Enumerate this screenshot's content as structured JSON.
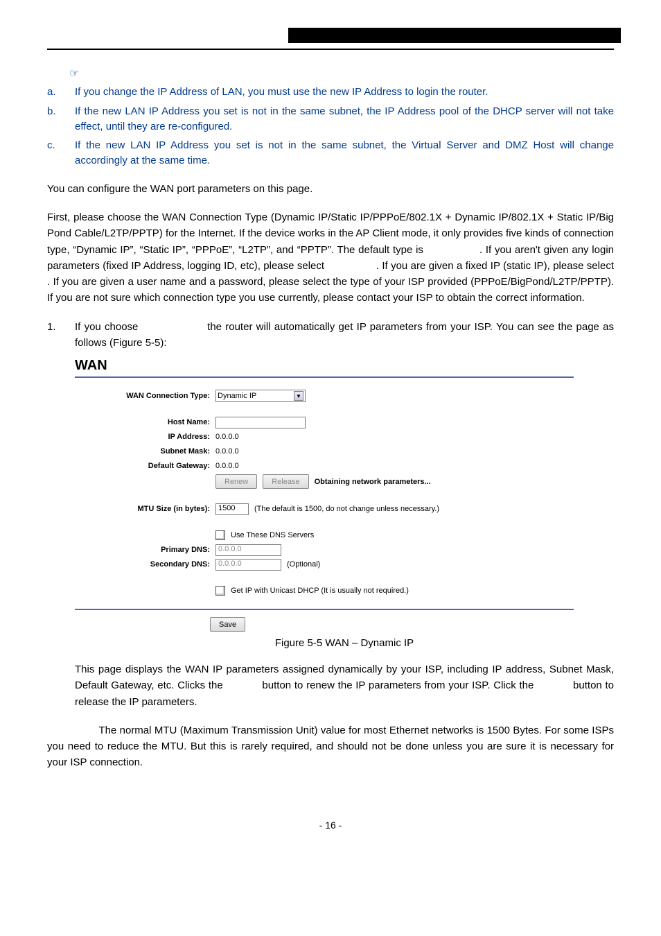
{
  "notes": {
    "hand": "☞",
    "items": [
      {
        "letter": "a.",
        "text": "If you change the IP Address of LAN, you must use the new IP Address to login the router."
      },
      {
        "letter": "b.",
        "text": "If the new LAN IP Address you set is not in the same subnet, the IP Address pool of the DHCP server will not take effect, until they are re-configured."
      },
      {
        "letter": "c.",
        "text": "If the new LAN IP Address you set is not in the same subnet, the Virtual Server and DMZ Host will change accordingly at the same time."
      }
    ]
  },
  "para1": "You can configure the WAN port parameters on this page.",
  "para2": "First, please choose the WAN Connection Type (Dynamic IP/Static IP/PPPoE/802.1X + Dynamic IP/802.1X + Static IP/Big Pond Cable/L2TP/PPTP) for the Internet. If the device works in the AP Client mode, it only provides five kinds of connection type, “Dynamic IP”, “Static IP”, “PPPoE”, “L2TP”, and “PPTP”. The default type is                 . If you aren't given any login parameters (fixed IP Address, logging ID, etc), please select                 . If you are given a fixed IP (static IP), please select             . If you are given a user name and a password, please select the type of your ISP provided (PPPoE/BigPond/L2TP/PPTP). If you are not sure which connection type you use currently, please contact your ISP to obtain the correct information.",
  "numitem": {
    "num": "1.",
    "text": "If you choose                   the router will automatically get IP parameters from your ISP. You can see the page as follows (Figure 5-5):"
  },
  "wan": {
    "title": "WAN",
    "labels": {
      "conn": "WAN Connection Type:",
      "host": "Host Name:",
      "ip": "IP Address:",
      "mask": "Subnet Mask:",
      "gw": "Default Gateway:",
      "mtu": "MTU Size (in bytes):",
      "pdns": "Primary DNS:",
      "sdns": "Secondary DNS:"
    },
    "values": {
      "conn": "Dynamic IP",
      "host": "",
      "ip": "0.0.0.0",
      "mask": "0.0.0.0",
      "gw": "0.0.0.0",
      "mtu": "1500",
      "pdns": "0.0.0.0",
      "sdns": "0.0.0.0"
    },
    "buttons": {
      "renew": "Renew",
      "release": "Release",
      "save": "Save"
    },
    "status": "Obtaining network parameters...",
    "mtu_note": "(The default is 1500, do not change unless necessary.)",
    "use_dns": "Use These DNS Servers",
    "sdns_opt": "(Optional)",
    "unicast": "Get IP with Unicast DHCP (It is usually not required.)"
  },
  "caption": "Figure 5-5 WAN – Dynamic IP",
  "para3": "This page displays the WAN IP parameters assigned dynamically by your ISP, including IP address, Subnet Mask, Default Gateway, etc. Clicks the            button to renew the IP parameters from your ISP. Click the            button to release the IP parameters.",
  "para4": "                 The normal MTU (Maximum Transmission Unit) value for most Ethernet networks is 1500 Bytes. For some ISPs you need to reduce the MTU. But this is rarely required, and should not be done unless you are sure it is necessary for your ISP connection.",
  "pagenum": "- 16 -"
}
